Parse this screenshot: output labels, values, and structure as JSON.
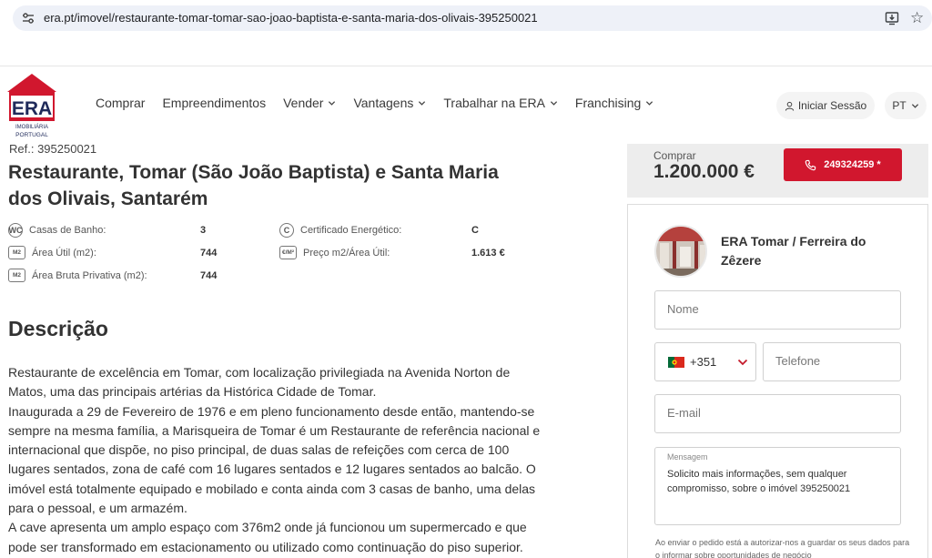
{
  "browser": {
    "url": "era.pt/imovel/restaurante-tomar-tomar-sao-joao-baptista-e-santa-maria-dos-olivais-395250021"
  },
  "header": {
    "logo_text": "ERA",
    "logo_sub1": "IMOBILIÁRIA",
    "logo_sub2": "PORTUGAL",
    "nav": [
      "Comprar",
      "Empreendimentos",
      "Vender",
      "Vantagens",
      "Trabalhar na ERA",
      "Franchising"
    ],
    "login_label": "Iniciar Sessão",
    "lang_label": "PT"
  },
  "property": {
    "ref": "Ref.: 395250021",
    "title": "Restaurante, Tomar (São João Baptista) e Santa Maria dos Olivais, Santarém",
    "features": [
      {
        "icon": "WC",
        "label": "Casas de Banho:",
        "value": "3"
      },
      {
        "icon": "M2",
        "label": "Área Útil (m2):",
        "value": "744"
      },
      {
        "icon": "M2",
        "label": "Área Bruta Privativa (m2):",
        "value": "744"
      },
      {
        "icon": "C",
        "label": "Certificado Energético:",
        "value": "C"
      },
      {
        "icon": "€/M²",
        "label": "Preço m2/Área Útil:",
        "value": "1.613 €"
      }
    ],
    "description_title": "Descrição",
    "description": "Restaurante de excelência em Tomar, com localização privilegiada na Avenida Norton de Matos, uma das principais artérias da Histórica Cidade de Tomar.\nInaugurada a 29 de Fevereiro de 1976 e em pleno funcionamento desde então, mantendo-se sempre na mesma família, a Marisqueira de Tomar é um Restaurante de referência nacional e internacional que dispõe, no piso principal, de duas salas de refeições com cerca de 100 lugares sentados, zona de café com 16 lugares sentados e 12 lugares sentados ao balcão. O imóvel está totalmente equipado e mobilado e conta ainda com 3 casas de banho, uma delas para o pessoal, e um armazém.\nA cave apresenta um amplo espaço com 376m2 onde já funcionou um supermercado e que pode ser transformado em estacionamento ou utilizado como continuação do piso superior."
  },
  "sidebar": {
    "price_label": "Comprar",
    "price": "1.200.000 €",
    "phone": "249324259 *",
    "agency": "ERA Tomar / Ferreira do Zêzere",
    "form": {
      "name_placeholder": "Nome",
      "country_code": "+351",
      "phone_placeholder": "Telefone",
      "email_placeholder": "E-mail",
      "message_label": "Mensagem",
      "message": "Solicito mais informações, sem qualquer compromisso, sobre o imóvel 395250021",
      "consent": "Ao enviar o pedido está a autorizar-nos a guardar os seus dados para o informar sobre oportunidades de negócio"
    }
  },
  "colors": {
    "brand_red": "#d1172e",
    "logo_navy": "#1f2a5a"
  }
}
